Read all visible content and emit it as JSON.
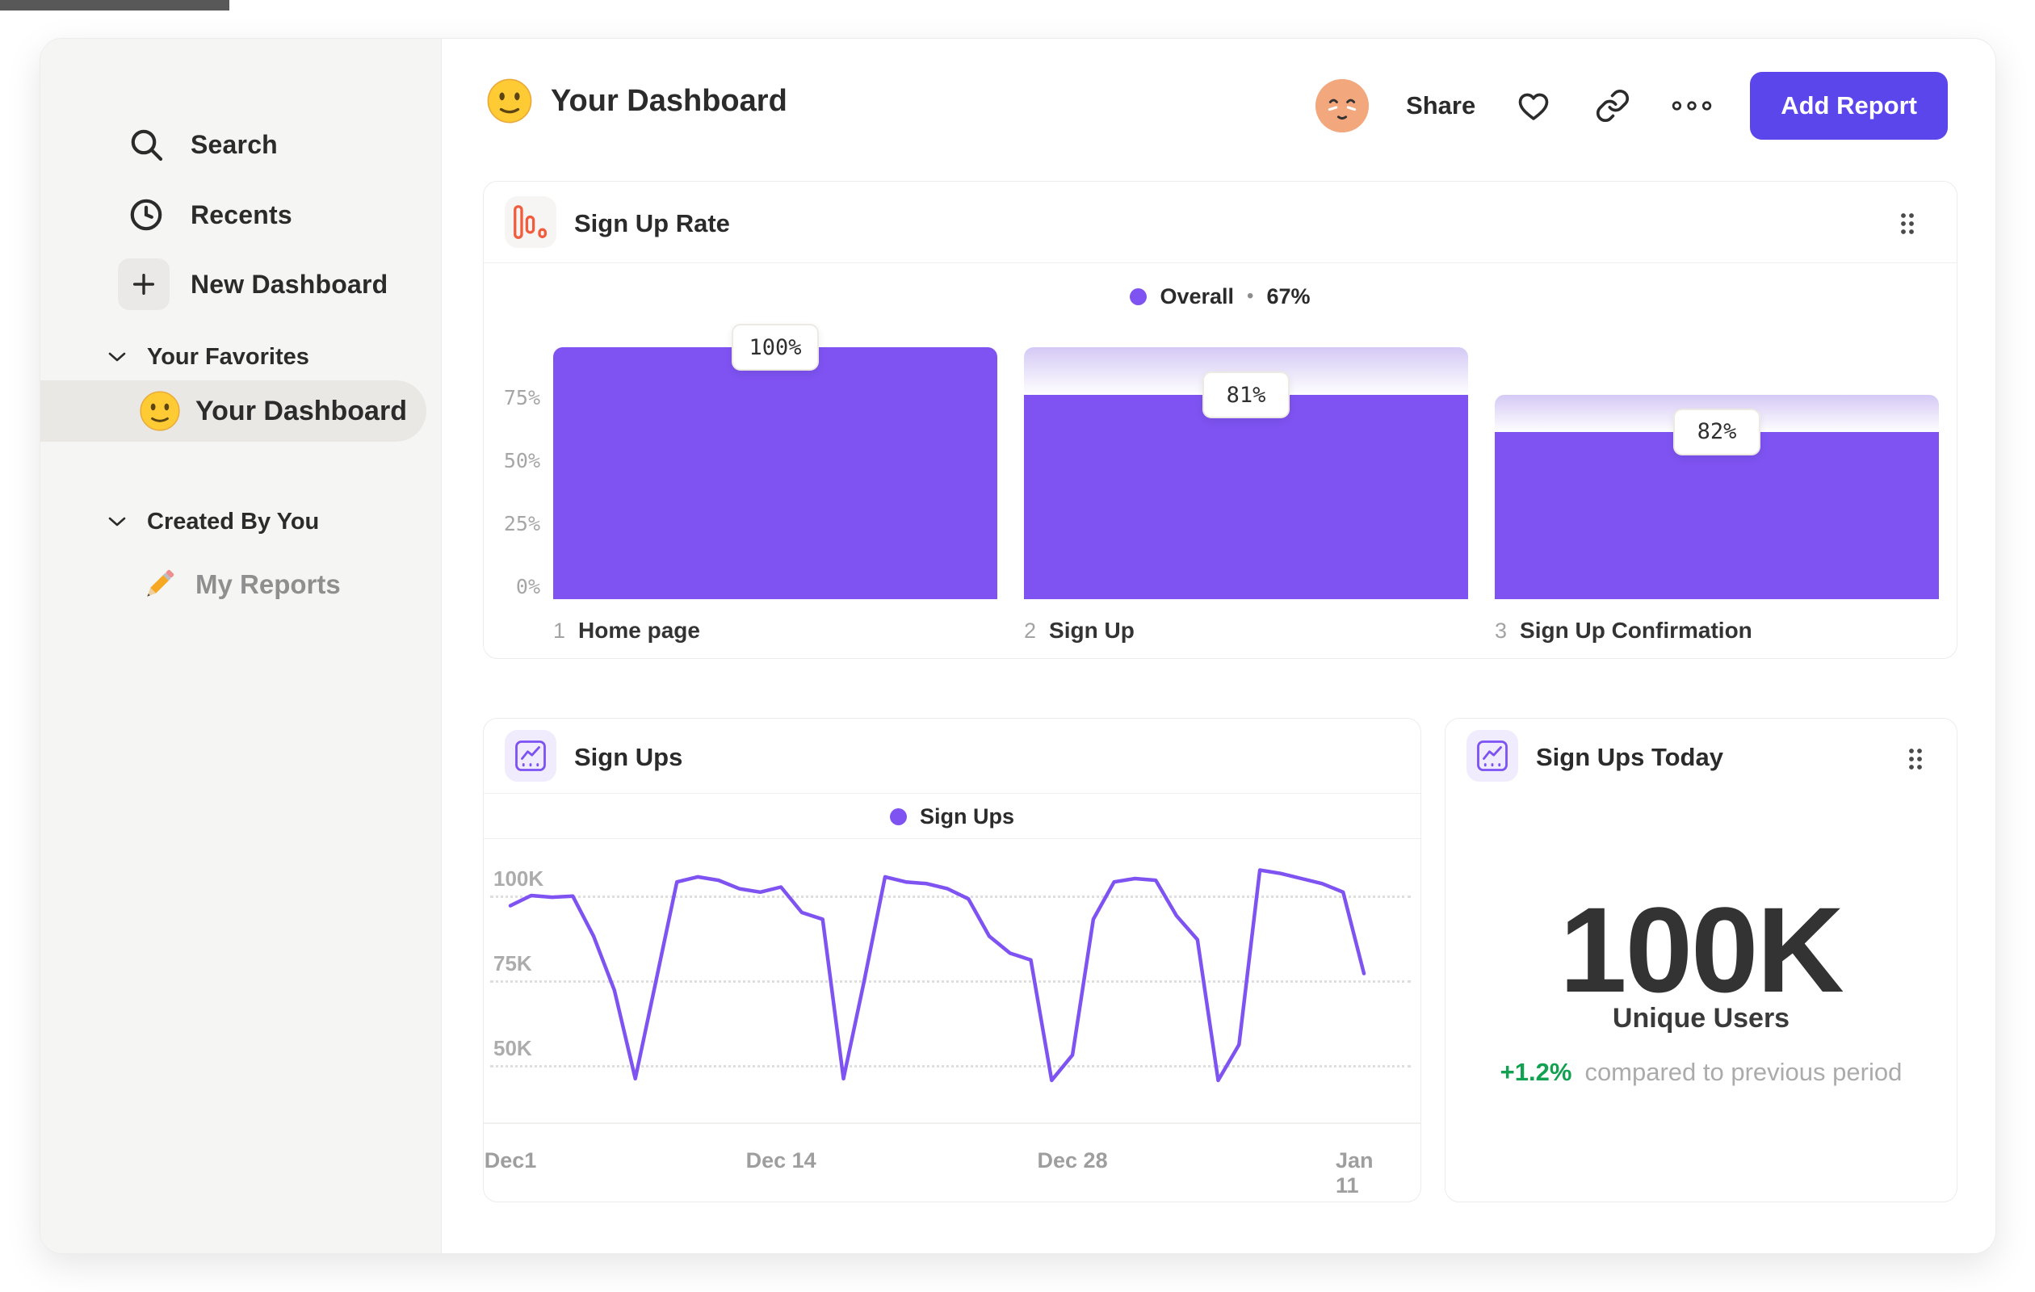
{
  "decor": {
    "top_left_strip_color": "#585858"
  },
  "sidebar": {
    "background": "#F5F5F4",
    "nav": [
      {
        "label": "Search",
        "icon": "search-icon"
      },
      {
        "label": "Recents",
        "icon": "clock-icon"
      },
      {
        "label": "New Dashboard",
        "icon": "plus-icon"
      }
    ],
    "sections": [
      {
        "label": "Your Favorites",
        "icon": "chevron-down-icon",
        "items": [
          {
            "label": "Your Dashboard",
            "icon": "smiley-emoji",
            "selected": true
          }
        ]
      },
      {
        "label": "Created By You",
        "icon": "chevron-down-icon",
        "items": [
          {
            "label": "My Reports",
            "icon": "pencil-emoji",
            "selected": false
          }
        ]
      }
    ]
  },
  "header": {
    "title": "Your Dashboard",
    "share_label": "Share",
    "add_report_label": "Add Report",
    "add_report_color": "#5B46EC",
    "icons": [
      "avatar-face",
      "heart-icon",
      "link-icon",
      "ellipsis-icon"
    ]
  },
  "cards": {
    "funnel": {
      "title": "Sign Up Rate",
      "icon": "bar-chart-icon",
      "icon_color": "#F05C3D",
      "legend_label": "Overall",
      "legend_separator": "•",
      "legend_value": "67%"
    },
    "line": {
      "title": "Sign Ups",
      "icon": "line-chart-icon",
      "icon_color": "#7C52F3",
      "legend_label": "Sign Ups"
    },
    "today": {
      "title": "Sign Ups Today",
      "icon": "line-chart-icon",
      "icon_color": "#7C52F3",
      "value": "100K",
      "value_label": "Unique Users",
      "delta": "+1.2%",
      "delta_color": "#12A150",
      "delta_note": "compared to previous period"
    }
  },
  "chart_data": [
    {
      "type": "bar",
      "subtype": "funnel",
      "title": "Sign Up Rate",
      "legend": "Overall",
      "overall_conversion_pct": 67,
      "categories": [
        "Home page",
        "Sign Up",
        "Sign Up Confirmation"
      ],
      "step_numbers": [
        "1",
        "2",
        "3"
      ],
      "step_conversion_labels": [
        "100%",
        "81%",
        "82%"
      ],
      "bar_heights_pct_of_total": [
        100,
        81,
        66.4
      ],
      "gradient_from_pct": [
        null,
        100,
        81
      ],
      "ylim": [
        0,
        100
      ],
      "yticks": [
        {
          "label": "75%",
          "value": 75
        },
        {
          "label": "50%",
          "value": 50
        },
        {
          "label": "25%",
          "value": 25
        },
        {
          "label": "0%",
          "value": 0
        }
      ],
      "bar_color": "#7E53F1",
      "grid": false,
      "legend_position": "top-center"
    },
    {
      "type": "line",
      "title": "Sign Ups",
      "legend": "Sign Ups",
      "unit": "K unique users per day",
      "x_ticks": [
        {
          "label": "Dec1",
          "day": 0
        },
        {
          "label": "Dec 14",
          "day": 13
        },
        {
          "label": "Dec 28",
          "day": 27
        },
        {
          "label": "Jan 11",
          "day": 41
        }
      ],
      "y_ticks": [
        {
          "label": "100K",
          "value": 100
        },
        {
          "label": "75K",
          "value": 75
        },
        {
          "label": "50K",
          "value": 50
        }
      ],
      "values_k": [
        97,
        100,
        99.5,
        99.8,
        88,
        72,
        46,
        75,
        104,
        105.5,
        104.5,
        102,
        101,
        102.5,
        95,
        93,
        46,
        75,
        105.5,
        104,
        103.5,
        102,
        99,
        88,
        83,
        81,
        45.5,
        53,
        93,
        104,
        105,
        104.5,
        94,
        87,
        45.5,
        56,
        107.5,
        106.5,
        105,
        103.5,
        101,
        77
      ],
      "line_color": "#7E53F1",
      "grid": "dotted horizontal",
      "legend_position": "top-center"
    }
  ]
}
